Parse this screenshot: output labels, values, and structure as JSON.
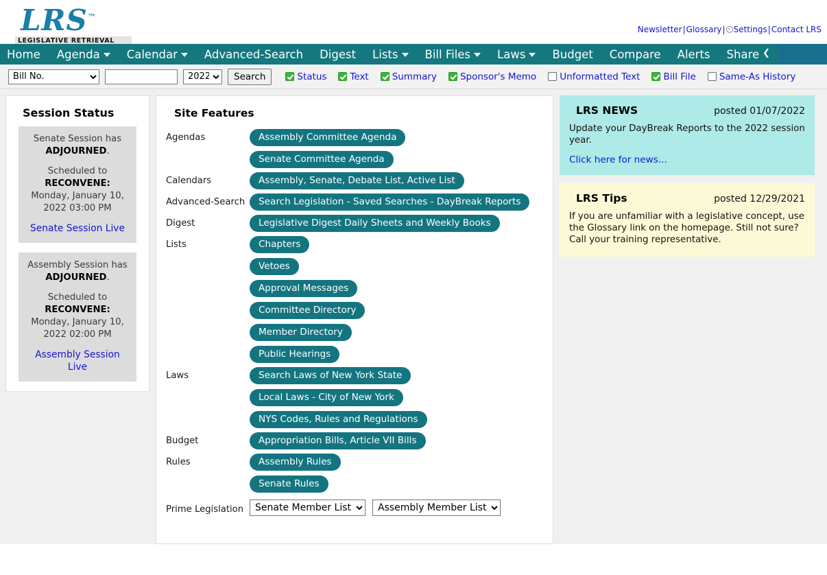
{
  "header": {
    "logo_text": "LRS",
    "logo_tm": "™",
    "logo_subtitle": "LEGISLATIVE RETRIEVAL SYSTEM",
    "top_links": [
      {
        "label": "Newsletter",
        "icon": null
      },
      {
        "label": "Glossary",
        "icon": null
      },
      {
        "label": "Settings",
        "icon": "gear-icon"
      },
      {
        "label": "Contact LRS",
        "icon": null
      }
    ],
    "link_separator": "|"
  },
  "nav": {
    "items": [
      {
        "label": "Home",
        "has_caret": false
      },
      {
        "label": "Agenda",
        "has_caret": true
      },
      {
        "label": "Calendar",
        "has_caret": true
      },
      {
        "label": "Advanced-Search",
        "has_caret": false
      },
      {
        "label": "Digest",
        "has_caret": false
      },
      {
        "label": "Lists",
        "has_caret": true
      },
      {
        "label": "Bill Files",
        "has_caret": true
      },
      {
        "label": "Laws",
        "has_caret": true
      },
      {
        "label": "Budget",
        "has_caret": false
      },
      {
        "label": "Compare",
        "has_caret": false
      },
      {
        "label": "Alerts",
        "has_caret": false
      },
      {
        "label": "Share",
        "has_caret": false,
        "icon": "share-icon",
        "icon_glyph": "❮"
      }
    ],
    "bar_color": "#14787e",
    "bar_right_color": "#1a6e8e"
  },
  "searchbar": {
    "field_select": {
      "value": "Bill No.",
      "options": [
        "Bill No."
      ]
    },
    "query_input": {
      "value": "",
      "placeholder": ""
    },
    "year_select": {
      "value": "2022",
      "options": [
        "2022"
      ]
    },
    "search_button": "Search",
    "checkboxes": [
      {
        "label": "Status",
        "checked": true
      },
      {
        "label": "Text",
        "checked": true
      },
      {
        "label": "Summary",
        "checked": true
      },
      {
        "label": "Sponsor's Memo",
        "checked": true
      },
      {
        "label": "Unformatted Text",
        "checked": false
      },
      {
        "label": "Bill File",
        "checked": true
      },
      {
        "label": "Same-As History",
        "checked": false
      }
    ]
  },
  "session_status": {
    "title": "Session Status",
    "sessions": [
      {
        "line1_prefix": "Senate Session has",
        "status": "ADJOURNED",
        "status_suffix": ".",
        "scheduled_label": "Scheduled to",
        "reconvene_label": "RECONVENE:",
        "datetime": "Monday, January 10, 2022 03:00 PM",
        "link": "Senate Session Live"
      },
      {
        "line1_prefix": "Assembly Session has",
        "status": "ADJOURNED",
        "status_suffix": ".",
        "scheduled_label": "Scheduled to",
        "reconvene_label": "RECONVENE:",
        "datetime": "Monday, January 10, 2022 02:00 PM",
        "link": "Assembly Session Live"
      }
    ]
  },
  "site_features": {
    "title": "Site Features",
    "rows": [
      {
        "label": "Agendas",
        "pills": [
          "Assembly Committee Agenda",
          "Senate Committee Agenda"
        ]
      },
      {
        "label": "Calendars",
        "pills": [
          "Assembly, Senate, Debate List, Active List"
        ]
      },
      {
        "label": "Advanced-Search",
        "pills": [
          "Search Legislation - Saved Searches - DayBreak Reports"
        ]
      },
      {
        "label": "Digest",
        "pills": [
          "Legislative Digest Daily Sheets and Weekly Books"
        ]
      },
      {
        "label": "Lists",
        "pills": [
          "Chapters",
          "Vetoes",
          "Approval Messages",
          "Committee Directory",
          "Member Directory",
          "Public Hearings"
        ]
      },
      {
        "label": "Laws",
        "pills": [
          "Search Laws of New York State",
          "Local Laws - City of New York",
          "NYS Codes, Rules and Regulations"
        ]
      },
      {
        "label": "Budget",
        "pills": [
          "Appropriation Bills, Article VII Bills"
        ]
      },
      {
        "label": "Rules",
        "pills": [
          "Assembly Rules",
          "Senate Rules"
        ]
      }
    ],
    "prime_legislation": {
      "label": "Prime Legislation",
      "selects": [
        {
          "value": "Senate Member List",
          "options": [
            "Senate Member List"
          ]
        },
        {
          "value": "Assembly Member List",
          "options": [
            "Assembly Member List"
          ]
        }
      ]
    }
  },
  "news_panel": {
    "title": "LRS NEWS",
    "posted": "posted 01/07/2022",
    "body": "Update your DayBreak Reports to the 2022 session year.",
    "link": "Click here for news...",
    "bg_color": "#aeeae7"
  },
  "tips_panel": {
    "title": "LRS Tips",
    "posted": "posted 12/29/2021",
    "body": "If you are unfamiliar with a legislative concept, use the Glossary link on the homepage. Still not sure? Call your training representative.",
    "bg_color": "#fcfad6"
  }
}
